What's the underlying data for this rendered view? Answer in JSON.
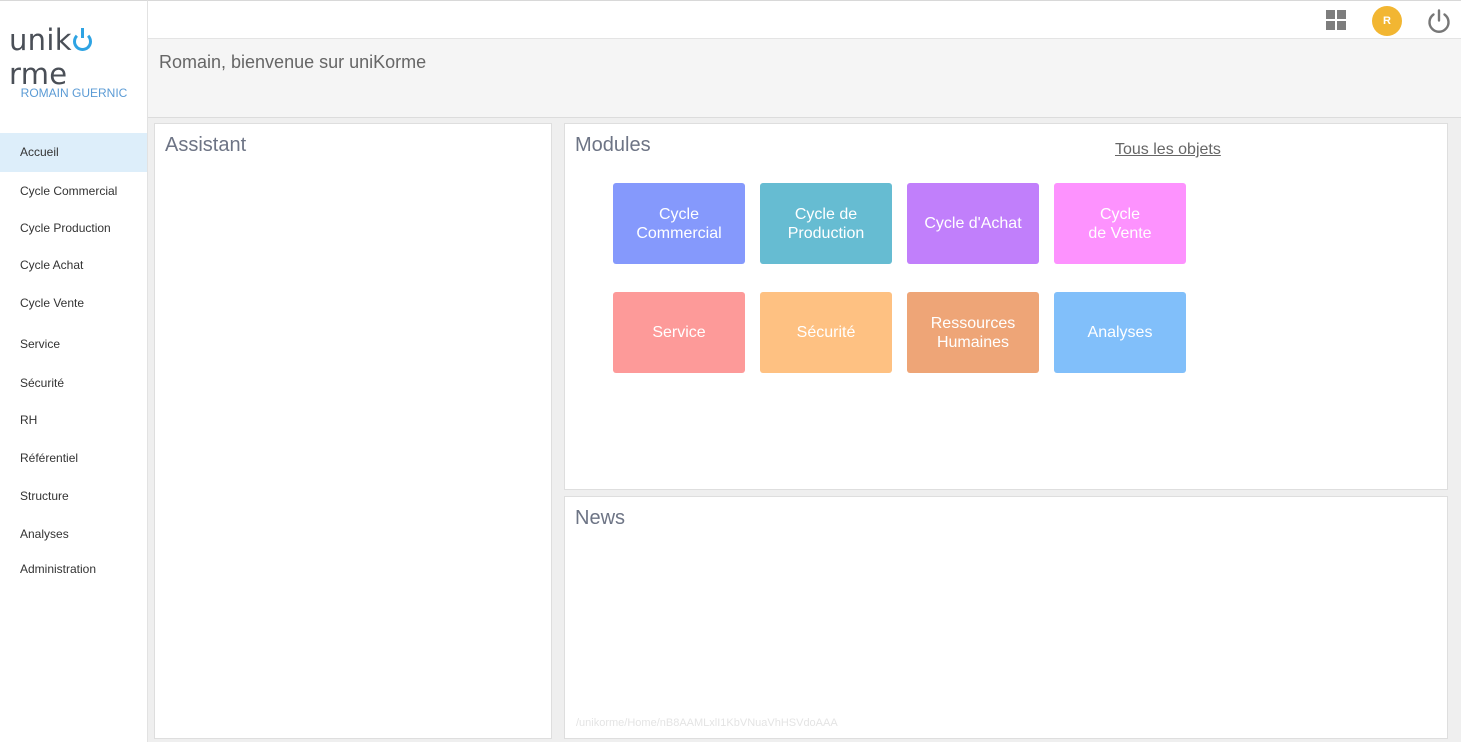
{
  "sidebar": {
    "logo_prefix": "unik",
    "logo_suffix": "rme",
    "user_name": "ROMAIN GUERNIC",
    "items": [
      {
        "label": "Accueil",
        "active": true
      },
      {
        "label": "Cycle Commercial"
      },
      {
        "label": "Cycle Production"
      },
      {
        "label": "Cycle Achat"
      },
      {
        "label": "Cycle Vente"
      },
      {
        "label": "Service"
      },
      {
        "label": "Sécurité"
      },
      {
        "label": "RH"
      },
      {
        "label": "Référentiel"
      },
      {
        "label": "Structure"
      },
      {
        "label": "Analyses"
      },
      {
        "label": "Administration"
      }
    ]
  },
  "topbar": {
    "avatar_initial": "R",
    "grid_icon": "grid-icon",
    "power_icon": "power-icon"
  },
  "welcome": {
    "text": "Romain, bienvenue sur uniKorme"
  },
  "assistant": {
    "title": "Assistant"
  },
  "modules": {
    "title": "Modules",
    "all_objects_link": "Tous les objets",
    "tiles": [
      {
        "label": "Cycle\nCommercial",
        "color": "#8599fc"
      },
      {
        "label": "Cycle de\nProduction",
        "color": "#66bcd2"
      },
      {
        "label": "Cycle d'Achat",
        "color": "#c17ffb"
      },
      {
        "label": "Cycle\nde Vente",
        "color": "#fd92fe"
      },
      {
        "label": "Service",
        "color": "#fd9a99"
      },
      {
        "label": "Sécurité",
        "color": "#fec182"
      },
      {
        "label": "Ressources\nHumaines",
        "color": "#eea577"
      },
      {
        "label": "Analyses",
        "color": "#81bffa"
      }
    ]
  },
  "news": {
    "title": "News",
    "url": "/unikorme/Home/nB8AAMLxlI1KbVNuaVhHSVdoAAA"
  },
  "colors": {
    "accent": "#2ea3e3",
    "active_bg": "#ddeefa",
    "avatar_bg": "#f2b632"
  }
}
